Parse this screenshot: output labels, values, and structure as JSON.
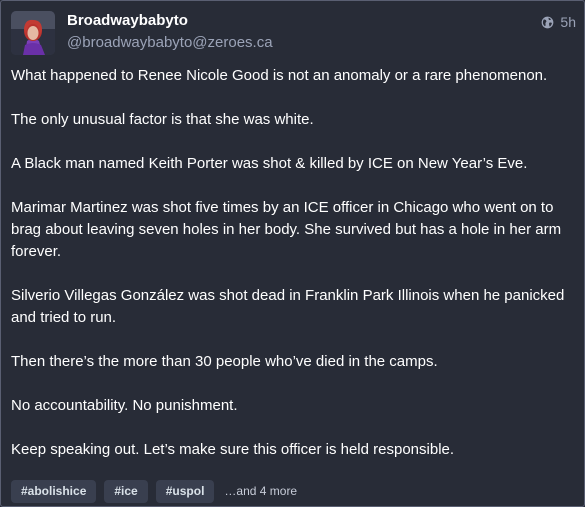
{
  "post": {
    "author": {
      "display_name": "Broadwaybabyto",
      "handle": "@broadwaybabyto@zeroes.ca"
    },
    "visibility_icon": "globe-icon",
    "time": "5h",
    "paragraphs": [
      "What happened to Renee Nicole Good is not an anomaly or a rare phenomenon.",
      "The only unusual factor is that she was white.",
      "A Black man named Keith Porter was shot & killed by ICE on New Year’s Eve.",
      "Marimar Martinez was shot five times by an ICE officer in Chicago who went on to brag about leaving seven holes in her body. She survived but has a hole in her arm forever.",
      "Silverio Villegas González was shot dead in Franklin Park Illinois when he panicked and tried to run.",
      "Then there’s the more than 30 people who’ve died in the camps.",
      "No accountability. No punishment.",
      "Keep speaking out. Let’s make sure this officer is held responsible."
    ],
    "hashtags": [
      "#abolishice",
      "#ice",
      "#uspol"
    ],
    "more_tags": "…and 4 more"
  },
  "colors": {
    "background": "#282c37",
    "text": "#ffffff",
    "muted": "#9ba3b7",
    "tag_bg": "#393f4f"
  }
}
